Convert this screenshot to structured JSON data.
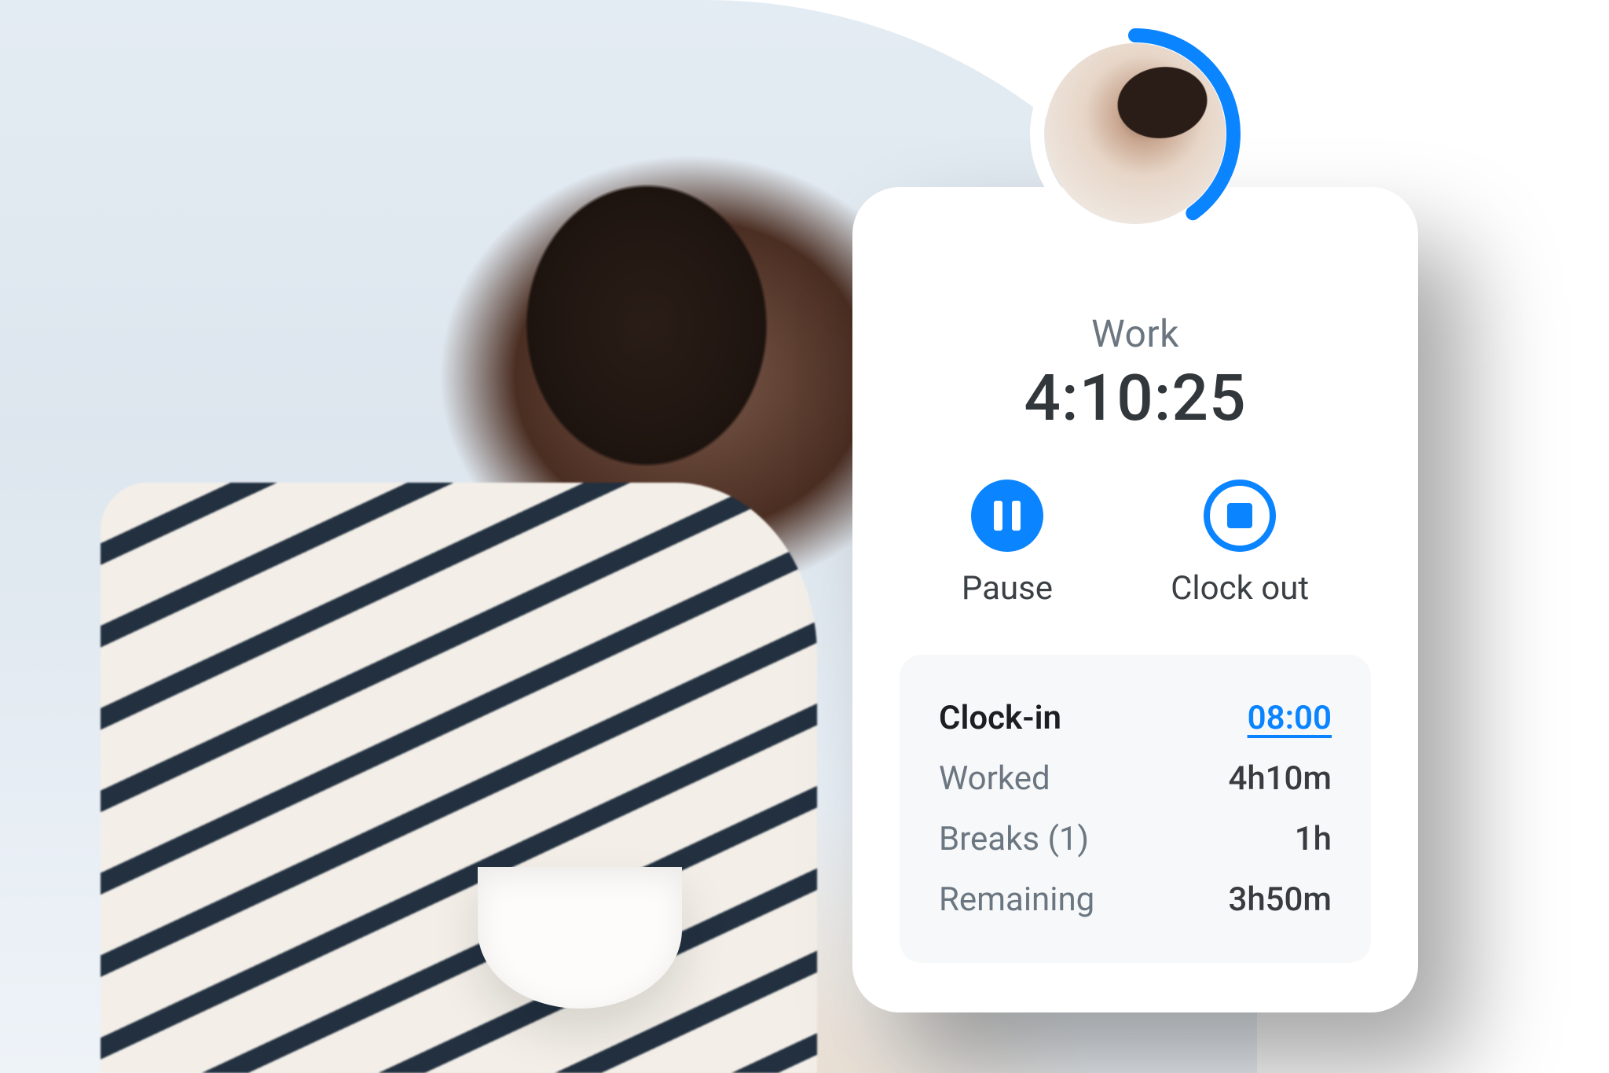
{
  "colors": {
    "accent": "#0a84ff"
  },
  "avatar_progress_percent": 40,
  "status_label": "Work",
  "timer": "4:10:25",
  "controls": {
    "pause_label": "Pause",
    "clock_out_label": "Clock out"
  },
  "stats": {
    "clock_in": {
      "label": "Clock-in",
      "value": "08:00"
    },
    "worked": {
      "label": "Worked",
      "value": "4h10m"
    },
    "breaks": {
      "label": "Breaks (1)",
      "value": "1h"
    },
    "remaining": {
      "label": "Remaining",
      "value": "3h50m"
    }
  }
}
